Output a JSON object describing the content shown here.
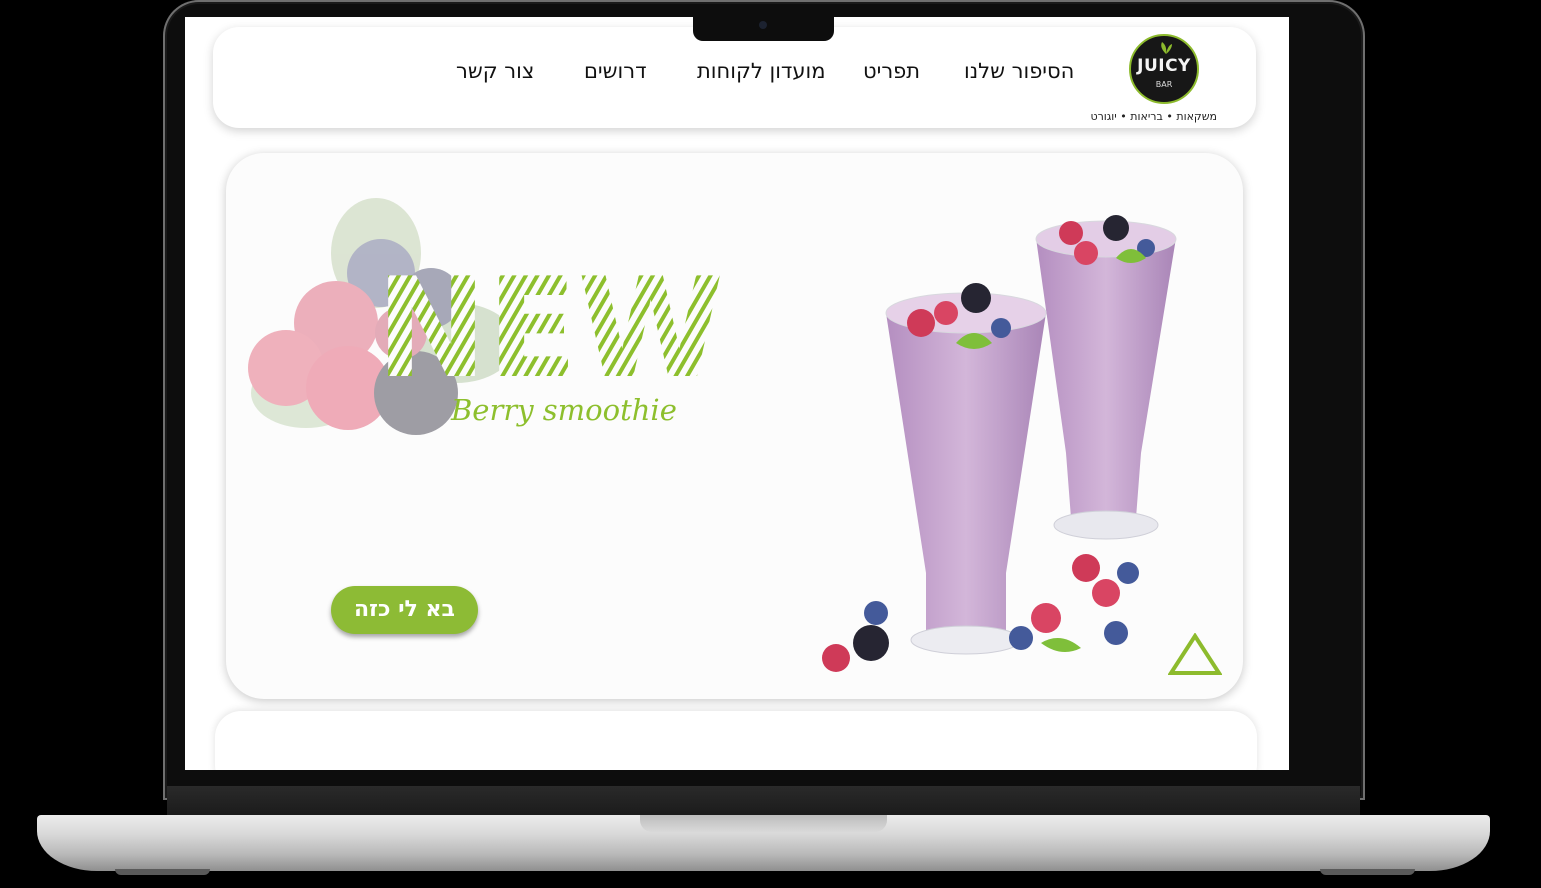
{
  "header": {
    "logo": {
      "text": "JUICY",
      "sub": "BAR",
      "tagline": "משקאות • בריאות • יוגורט"
    },
    "nav": [
      {
        "label": "הסיפור שלנו"
      },
      {
        "label": "תפריט"
      },
      {
        "label": "מועדון לקוחות"
      },
      {
        "label": "דרושים"
      },
      {
        "label": "צור קשר"
      }
    ]
  },
  "hero": {
    "title": "NEW",
    "subtitle": "Berry smoothie",
    "cta_label": "בא לי כזה"
  },
  "colors": {
    "accent_green": "#8dbb35",
    "smoothie_pink": "#c7a6cf",
    "laptop_silver": "#d8d8d8"
  },
  "icons": [
    "berries-image",
    "smoothie-glasses-image",
    "scroll-up-triangle-icon",
    "leaf-icon"
  ]
}
